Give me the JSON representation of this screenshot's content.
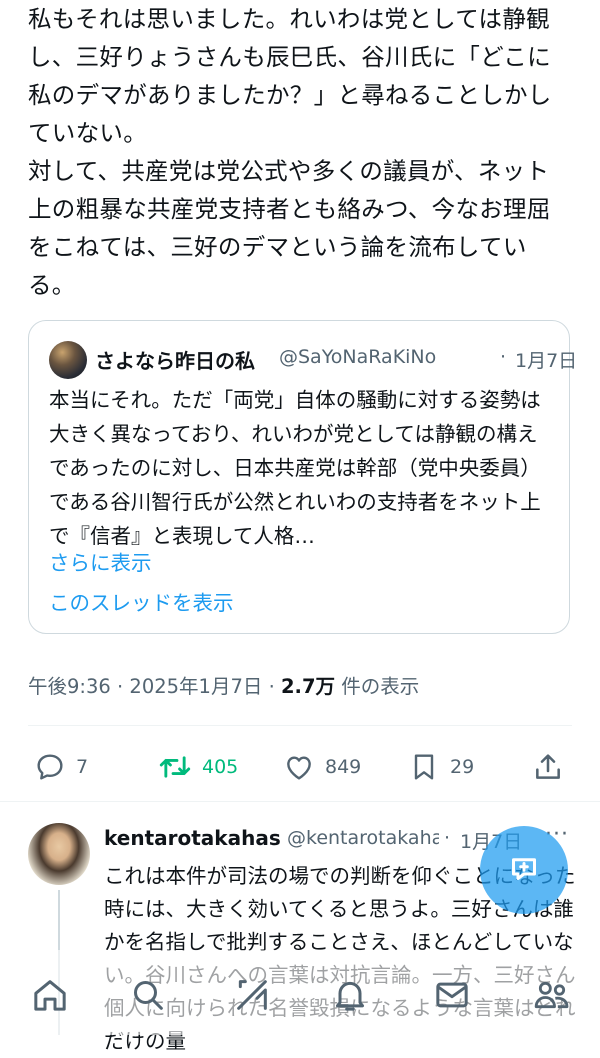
{
  "post": {
    "text": "私もそれは思いました。れいわは党としては静観し、三好りょうさんも辰巳氏、谷川氏に「どこに私のデマがありましたか？」と尋ねることしかしていない。\n対して、共産党は党公式や多くの議員が、ネット上の粗暴な共産党支持者とも絡みつ、今なお理屈をこねては、三好のデマという論を流布している。"
  },
  "quote": {
    "name": "さよなら昨日の私",
    "handle": "@SaYoNaRaKiNo",
    "dot": "·",
    "date": "1月7日",
    "text": "本当にそれ。ただ「両党」自体の騒動に対する姿勢は大きく異なっており、れいわが党としては静観の構えであったのに対し、日本共産党は幹部（党中央委員）である谷川智行氏が公然とれいわの支持者をネット上で『信者』と表現して人格…",
    "show_more": "さらに表示",
    "show_thread": "このスレッドを表示"
  },
  "meta": {
    "time": "午後9:36",
    "sep1": "·",
    "date": "2025年1月7日",
    "sep2": "·",
    "views": "2.7万",
    "views_label": "件の表示"
  },
  "actions": {
    "replies": "7",
    "reposts": "405",
    "likes": "849",
    "bookmarks": "29"
  },
  "reply": {
    "name": "kentarotakahashi",
    "handle": "@kentarotakahashi",
    "dot": "·",
    "date": "1月7日",
    "more": "···",
    "text": "これは本件が司法の場での判断を仰ぐことになった時には、大きく効いてくると思うよ。三好さんは誰かを名指しで批判することさえ、ほとんどしていない。谷川さんへの言葉は対抗言論。一方、三好さん個人に向けられた名誉毀損になるような言葉はどれだけの量"
  },
  "colors": {
    "accent": "#1d9bf0",
    "repost_green": "#00ba7c",
    "secondary_text": "#536471",
    "border": "#cfd9de"
  },
  "icons": {
    "reply": "speech-bubble-icon",
    "repost": "repost-arrows-icon",
    "like": "heart-icon",
    "bookmark": "bookmark-icon",
    "share": "share-icon",
    "fab": "compose-icon",
    "tabs": [
      "home-icon",
      "search-icon",
      "grok-icon",
      "notifications-icon",
      "messages-icon",
      "communities-icon"
    ]
  }
}
